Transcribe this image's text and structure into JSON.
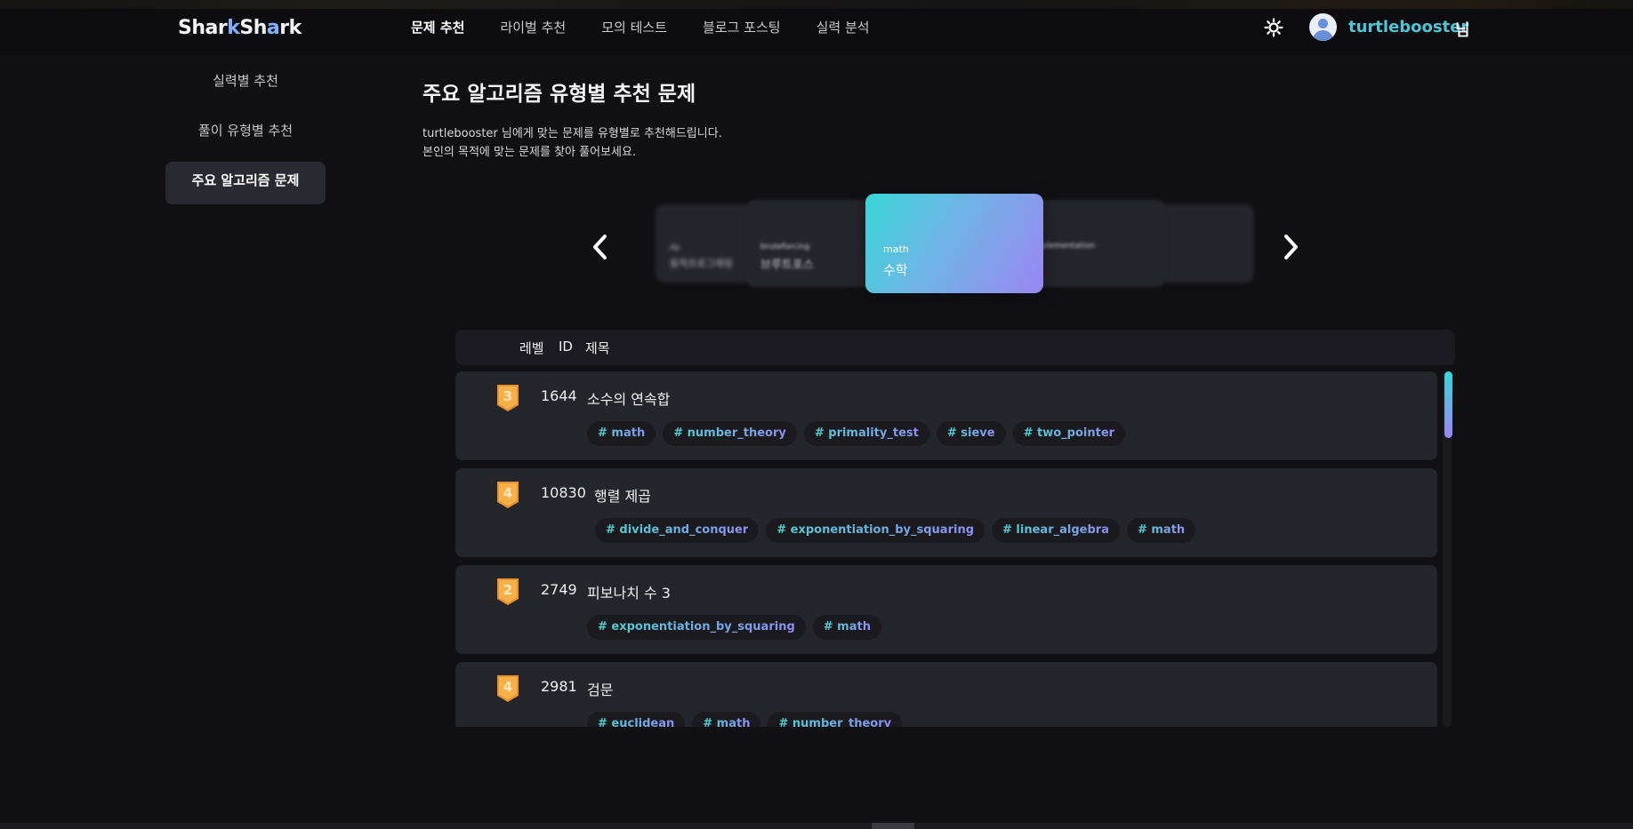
{
  "header": {
    "logo_a": "Shar",
    "logo_b": "k",
    "logo_c": "Sh",
    "logo_d": "a",
    "logo_e": "rk",
    "nav": [
      {
        "label": "문제 추천",
        "active": true
      },
      {
        "label": "라이벌 추천",
        "active": false
      },
      {
        "label": "모의 테스트",
        "active": false
      },
      {
        "label": "블로그 포스팅",
        "active": false
      },
      {
        "label": "실력 분석",
        "active": false
      }
    ],
    "username": "turtlebooster",
    "username_suffix": "님"
  },
  "sidebar": {
    "items": [
      {
        "label": "실력별 추천",
        "active": false
      },
      {
        "label": "풀이 유형별 추천",
        "active": false
      },
      {
        "label": "주요 알고리즘 문제",
        "active": true
      }
    ]
  },
  "main": {
    "title": "주요 알고리즘 유형별 추천 문제",
    "desc_line1": "turtlebooster 님에게 맞는 문제를 유형별로 추천해드립니다.",
    "desc_line2": "본인의 목적에 맞는 문제를 찾아 풀어보세요."
  },
  "carousel": {
    "far_left": {
      "en": "dp",
      "ko": "동적프로그래밍"
    },
    "left": {
      "en": "bruteforcing",
      "ko": "브루트포스"
    },
    "active": {
      "en": "math",
      "ko": "수학"
    },
    "right": {
      "en": "implementation",
      "ko": ""
    }
  },
  "table": {
    "headers": {
      "level": "레벨",
      "id": "ID",
      "title": "제목"
    },
    "rows": [
      {
        "level": "3",
        "id": "1644",
        "title": "소수의 연속합",
        "tags": [
          "# math",
          "# number_theory",
          "# primality_test",
          "# sieve",
          "# two_pointer"
        ]
      },
      {
        "level": "4",
        "id": "10830",
        "title": "행렬 제곱",
        "tags": [
          "# divide_and_conquer",
          "# exponentiation_by_squaring",
          "# linear_algebra",
          "# math"
        ]
      },
      {
        "level": "2",
        "id": "2749",
        "title": "피보나치 수 3",
        "tags": [
          "# exponentiation_by_squaring",
          "# math"
        ]
      },
      {
        "level": "4",
        "id": "2981",
        "title": "검문",
        "tags": [
          "# euclidean",
          "# math",
          "# number_theory"
        ]
      }
    ]
  },
  "colors": {
    "accent_cyan": "#38d6d6",
    "accent_purple": "#9b86f2",
    "badge_gold": "#f0a73a"
  }
}
